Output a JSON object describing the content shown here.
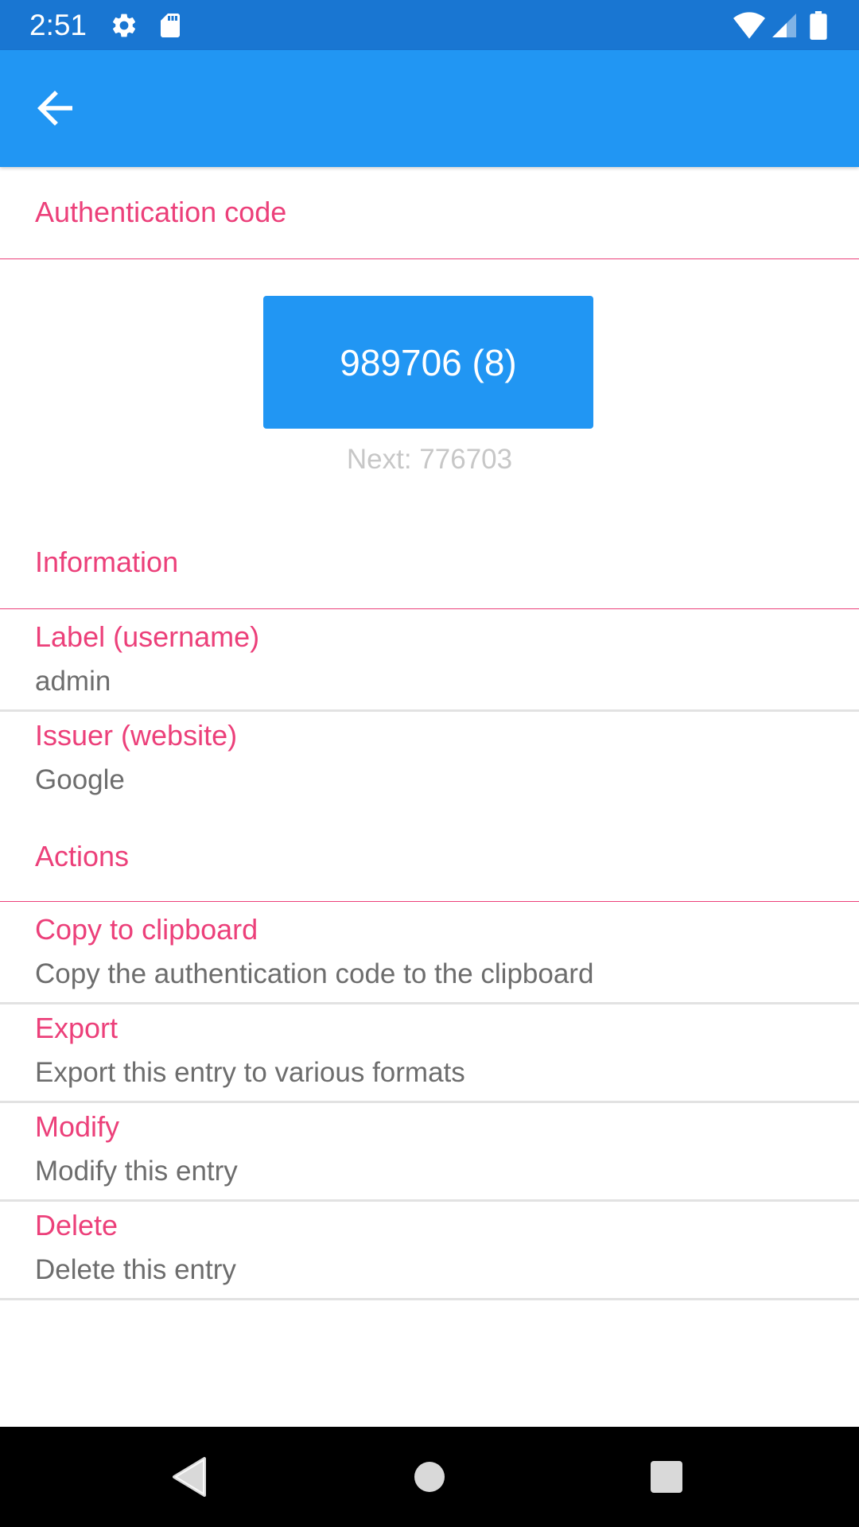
{
  "status_bar": {
    "time": "2:51",
    "background": "#1976d2",
    "icons": [
      "settings-icon",
      "sd-card-icon",
      "wifi-icon",
      "cellular-signal-icon",
      "battery-icon"
    ]
  },
  "app_bar": {
    "background": "#2196f3",
    "back_icon": "arrow-back-icon"
  },
  "auth_section": {
    "title": "Authentication code",
    "code": "989706 (8)",
    "next": "Next: 776703"
  },
  "info_section": {
    "title": "Information",
    "items": [
      {
        "title": "Label (username)",
        "value": "admin"
      },
      {
        "title": "Issuer (website)",
        "value": "Google"
      }
    ]
  },
  "actions_section": {
    "title": "Actions",
    "items": [
      {
        "title": "Copy to clipboard",
        "subtitle": "Copy the authentication code to the clipboard"
      },
      {
        "title": "Export",
        "subtitle": "Export this entry to various formats"
      },
      {
        "title": "Modify",
        "subtitle": "Modify this entry"
      },
      {
        "title": "Delete",
        "subtitle": "Delete this entry"
      }
    ]
  },
  "nav_bar": {
    "icons": [
      "nav-back-icon",
      "nav-home-icon",
      "nav-recents-icon"
    ]
  },
  "colors": {
    "accent": "#ec407a",
    "primary": "#2196f3",
    "primary_dark": "#1976d2",
    "secondary_text": "#6d6d6d",
    "hint_text": "#c7c7c7"
  }
}
